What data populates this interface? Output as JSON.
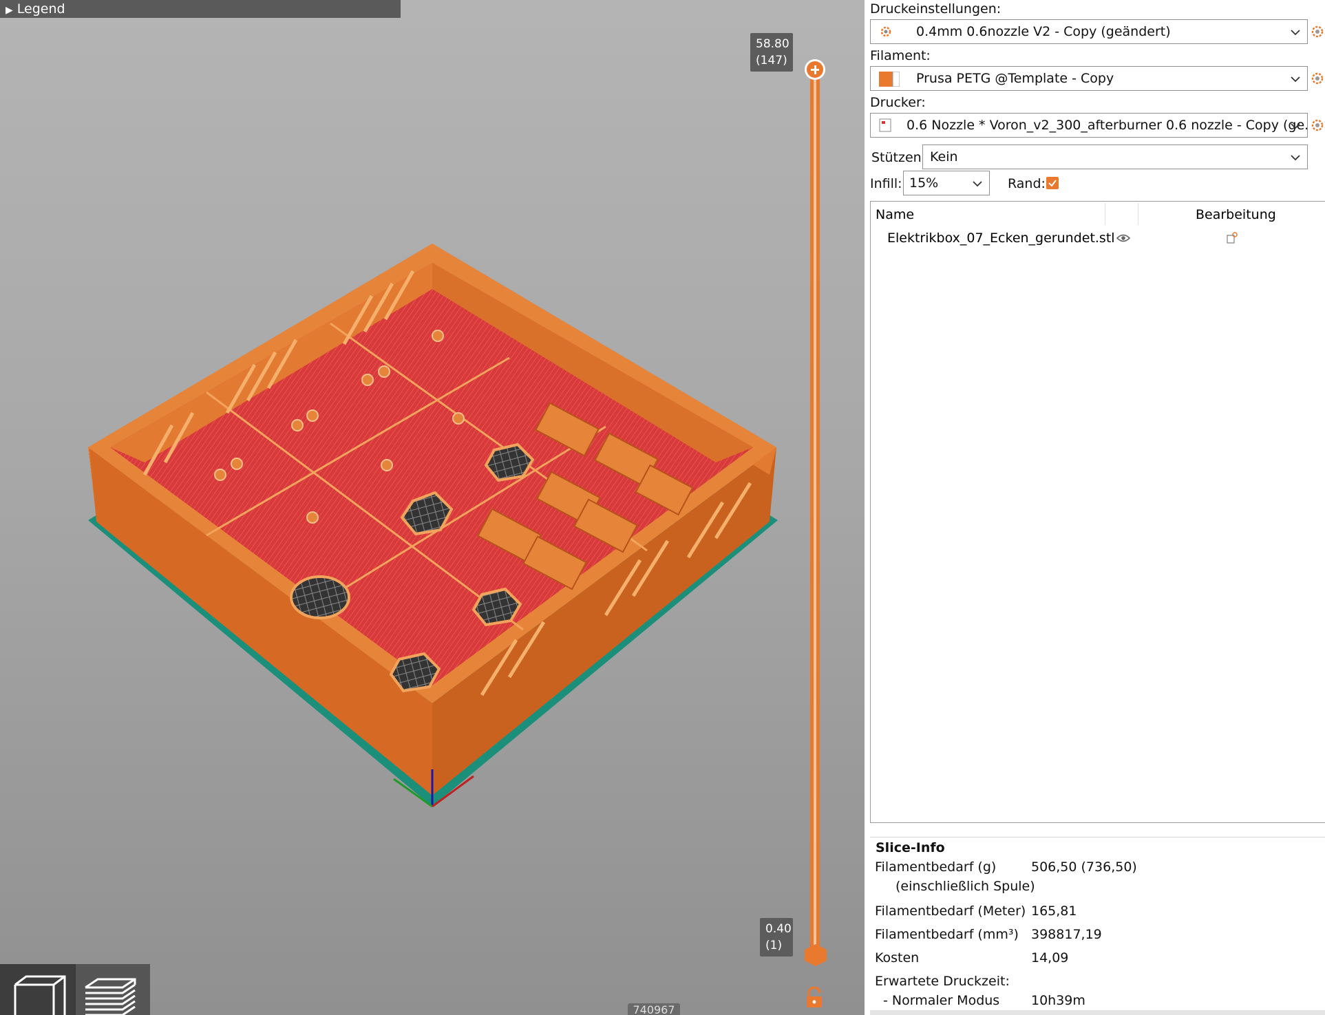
{
  "viewport": {
    "legend_label": "Legend",
    "slider_top_value": "58.80",
    "slider_top_layer": "(147)",
    "slider_bottom_value": "0.40",
    "slider_bottom_layer": "(1)",
    "move_counter": "740967",
    "accent_color": "#e8792e"
  },
  "settings": {
    "print_label": "Druckeinstellungen:",
    "print_value": "0.4mm 0.6nozzle V2 - Copy (geändert)",
    "filament_label": "Filament:",
    "filament_value": "Prusa PETG @Template - Copy",
    "printer_label": "Drucker:",
    "printer_value": "0.6 Nozzle * Voron_v2_300_afterburner 0.6 nozzle - Copy (ge...",
    "supports_label": "Stützen:",
    "supports_value": "Kein",
    "infill_label": "Infill:",
    "infill_value": "15%",
    "brim_label": "Rand:",
    "brim_checked": true
  },
  "object_list": {
    "col_name": "Name",
    "col_edit": "Bearbeitung",
    "items": [
      {
        "name": "Elektrikbox_07_Ecken_gerundet.stl"
      }
    ]
  },
  "slice_info": {
    "title": "Slice-Info",
    "rows": [
      {
        "label": "Filamentbedarf (g)",
        "value": "506,50 (736,50)"
      },
      {
        "label": "(einschließlich Spule)",
        "value": ""
      },
      {
        "label": "Filamentbedarf (Meter)",
        "value": "165,81"
      },
      {
        "label": "Filamentbedarf (mm³)",
        "value": "398817,19"
      },
      {
        "label": "Kosten",
        "value": "14,09"
      },
      {
        "label": "Erwartete Druckzeit:",
        "value": ""
      },
      {
        "label": "- Normaler Modus",
        "value": "10h39m"
      }
    ]
  }
}
